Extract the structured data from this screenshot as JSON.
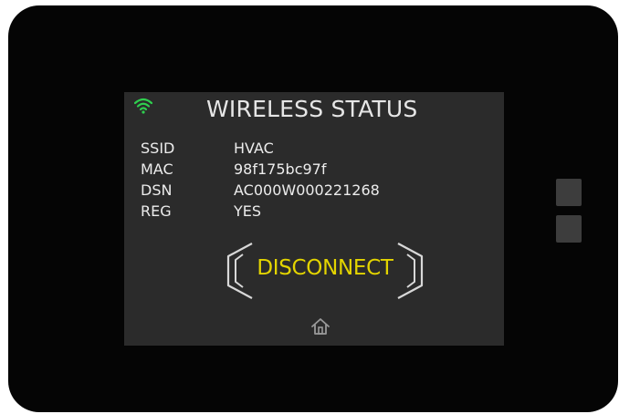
{
  "header": {
    "title": "WIRELESS STATUS",
    "wifi_icon": "wifi-icon",
    "wifi_color": "#2fcf4e"
  },
  "info": {
    "rows": [
      {
        "label": "SSID",
        "value": "HVAC"
      },
      {
        "label": "MAC",
        "value": "98f175bc97f"
      },
      {
        "label": "DSN",
        "value": "AC000W000221268"
      },
      {
        "label": "REG",
        "value": "YES"
      }
    ]
  },
  "actions": {
    "disconnect_label": "DISCONNECT",
    "disconnect_color": "#e3d400",
    "home_icon": "home-icon"
  },
  "device": {
    "side_buttons": [
      "side-button-top",
      "side-button-bottom"
    ]
  }
}
